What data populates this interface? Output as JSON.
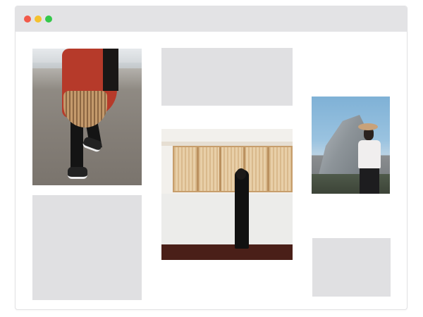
{
  "window": {
    "controls": [
      {
        "name": "close",
        "color": "#f25a4a"
      },
      {
        "name": "minimize",
        "color": "#f5c12e"
      },
      {
        "name": "maximize",
        "color": "#34c84a"
      }
    ]
  },
  "colors": {
    "titlebar": "#e3e3e5",
    "placeholder": "#e0e0e2",
    "background": "#ffffff"
  },
  "gallery": {
    "tiles": [
      {
        "kind": "photo",
        "subject": "beach-red-coat-bamboo-bag"
      },
      {
        "kind": "placeholder"
      },
      {
        "kind": "placeholder"
      },
      {
        "kind": "photo",
        "subject": "white-wall-bamboo-blinds-black-outfit"
      },
      {
        "kind": "photo",
        "subject": "half-dome-woman-in-hat"
      },
      {
        "kind": "placeholder"
      }
    ]
  }
}
